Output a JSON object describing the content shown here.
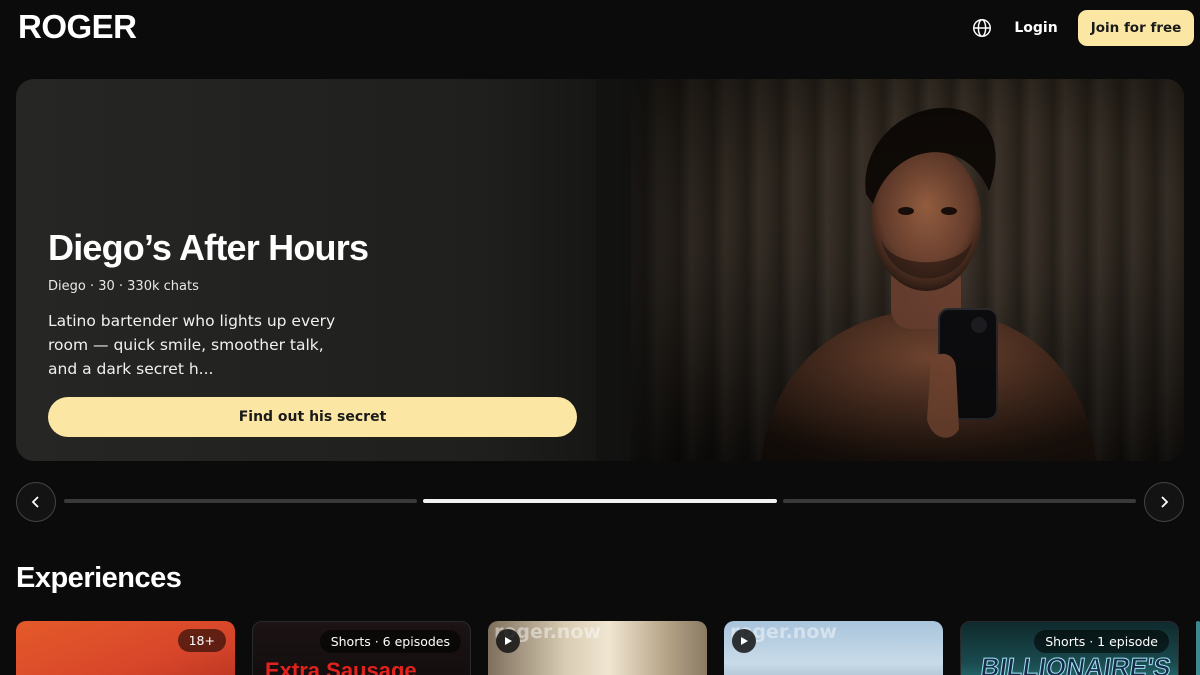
{
  "header": {
    "logo": "ROGER",
    "globe_icon": "globe-icon",
    "login_label": "Login",
    "join_label": "Join for free"
  },
  "hero": {
    "title": "Diego’s After Hours",
    "meta": "Diego · 30 · 330k chats",
    "description": "Latino bartender who lights up every room — quick smile, smoother talk, and a dark secret h...",
    "cta_label": "Find out his secret",
    "slides_total": 3,
    "active_slide": 2
  },
  "carousel": {
    "prev_icon": "chevron-left-icon",
    "next_icon": "chevron-right-icon"
  },
  "experiences": {
    "title": "Experiences",
    "cards": [
      {
        "badge": "18+",
        "art_text": "",
        "watermark": ""
      },
      {
        "badge": "Shorts · 6 episodes",
        "art_text": "Extra Sausage",
        "watermark": ""
      },
      {
        "badge": "",
        "art_text": "",
        "watermark": "roger.now"
      },
      {
        "badge": "",
        "art_text": "",
        "watermark": "roger.now"
      },
      {
        "badge": "Shorts · 1 episode",
        "art_text": "BILLIONAIRE'S",
        "watermark": ""
      }
    ]
  },
  "colors": {
    "background": "#0b0b0b",
    "accent": "#fbe7a3",
    "text": "#ffffff"
  }
}
